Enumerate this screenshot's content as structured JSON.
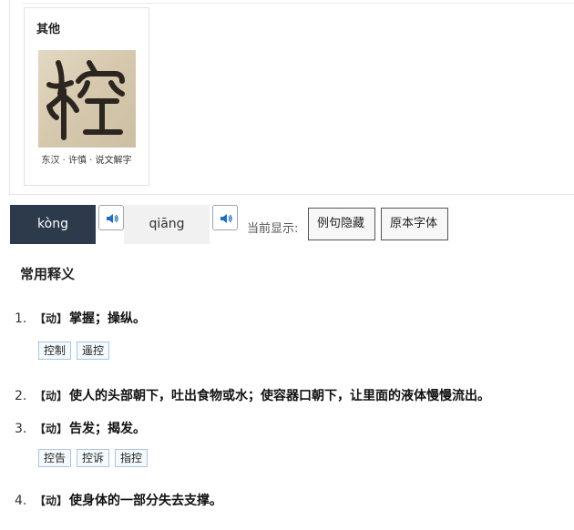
{
  "glyph_card": {
    "title": "其他",
    "caption": "东汉 · 许慎 · 说文解字",
    "image_icon": "seal-script-character-image"
  },
  "pinyin": {
    "tabs": [
      {
        "label": "kòng",
        "active": true
      },
      {
        "label": "qiāng",
        "active": false
      }
    ],
    "speaker_icon": "speaker-icon",
    "display_label": "当前显示:",
    "buttons": [
      {
        "label": "例句隐藏"
      },
      {
        "label": "原本字体"
      }
    ]
  },
  "section": {
    "title": "常用释义"
  },
  "definitions": [
    {
      "num": "1.",
      "pos": "【动】",
      "text": "掌握；操纵。",
      "tags": [
        "控制",
        "遥控"
      ]
    },
    {
      "num": "2.",
      "pos": "【动】",
      "text": "使人的头部朝下，吐出食物或水；使容器口朝下，让里面的液体慢慢流出。",
      "tags": []
    },
    {
      "num": "3.",
      "pos": "【动】",
      "text": "告发；揭发。",
      "tags": [
        "控告",
        "控诉",
        "指控"
      ]
    },
    {
      "num": "4.",
      "pos": "【动】",
      "text": "使身体的一部分失去支撑。",
      "tags": []
    }
  ],
  "colors": {
    "active_tab_bg": "#2d3a4b",
    "tag_border": "#a9c6e0",
    "tag_bg": "#f4f9fd"
  }
}
